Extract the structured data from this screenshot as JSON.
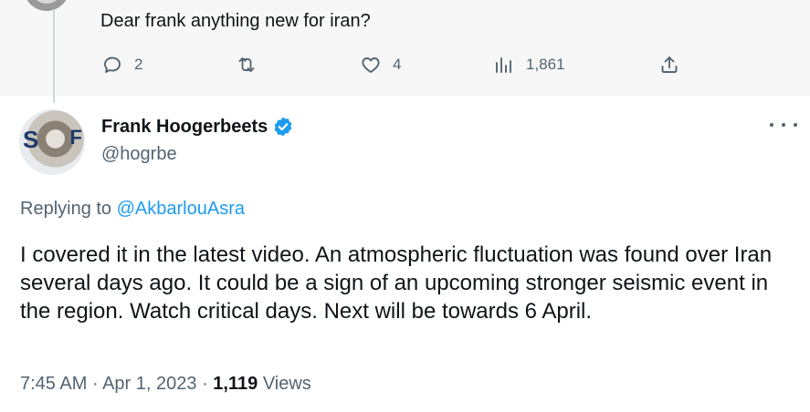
{
  "parent_tweet": {
    "text": "Dear frank anything new for iran?",
    "actions": {
      "reply_count": "2",
      "retweet_count": "",
      "like_count": "4",
      "views_count": "1,861"
    }
  },
  "tweet": {
    "author_name": "Frank Hoogerbeets",
    "author_handle": "@hogrbe",
    "replying_prefix": "Replying to",
    "replying_to": "@AkbarlouAsra",
    "text": "I covered it in the latest video. An atmospheric fluctuation was found over Iran several days ago. It could be a sign of an upcoming stronger seismic event in the region. Watch critical days. Next will be towards 6 April.",
    "time": "7:45 AM",
    "separator": "·",
    "date": "Apr 1, 2023",
    "views_count": "1,119",
    "views_label": "Views"
  },
  "colors": {
    "accent": "#1d9bf0",
    "muted_text": "#536471",
    "primary_text": "#0f1419",
    "parent_background": "#f7f7f7"
  },
  "icons": [
    "reply-icon",
    "retweet-icon",
    "like-icon",
    "views-icon",
    "share-icon",
    "verified-badge-icon",
    "more-options-icon"
  ]
}
